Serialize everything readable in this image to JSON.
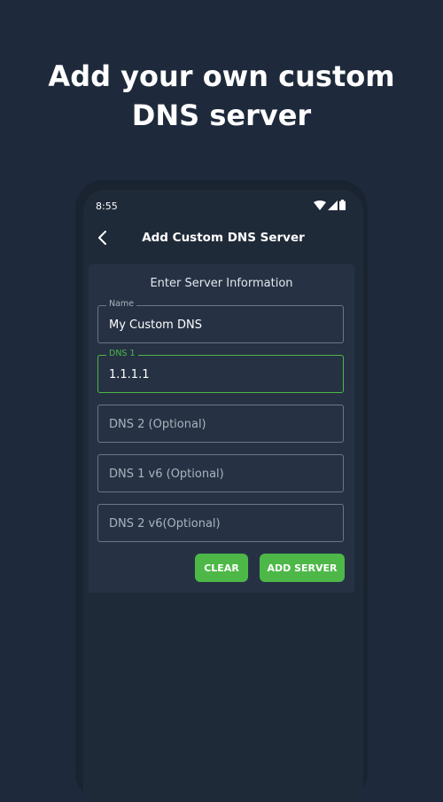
{
  "headline": {
    "line1": "Add your own custom",
    "line2": "DNS server"
  },
  "status_bar": {
    "time": "8:55"
  },
  "app_bar": {
    "title": "Add Custom DNS Server"
  },
  "form": {
    "title": "Enter Server Information",
    "fields": [
      {
        "label": "Name",
        "value": "My Custom DNS"
      },
      {
        "label": "DNS 1",
        "value": "1.1.1.1"
      },
      {
        "placeholder": "DNS 2 (Optional)"
      },
      {
        "placeholder": "DNS 1 v6 (Optional)"
      },
      {
        "placeholder": "DNS 2 v6(Optional)"
      }
    ],
    "clear_label": "CLEAR",
    "add_label": "ADD SERVER"
  },
  "colors": {
    "background": "#1e2a3b",
    "card": "#263244",
    "accent": "#4db848"
  },
  "icons": [
    "back-arrow-icon",
    "wifi-icon",
    "signal-icon",
    "battery-icon"
  ]
}
